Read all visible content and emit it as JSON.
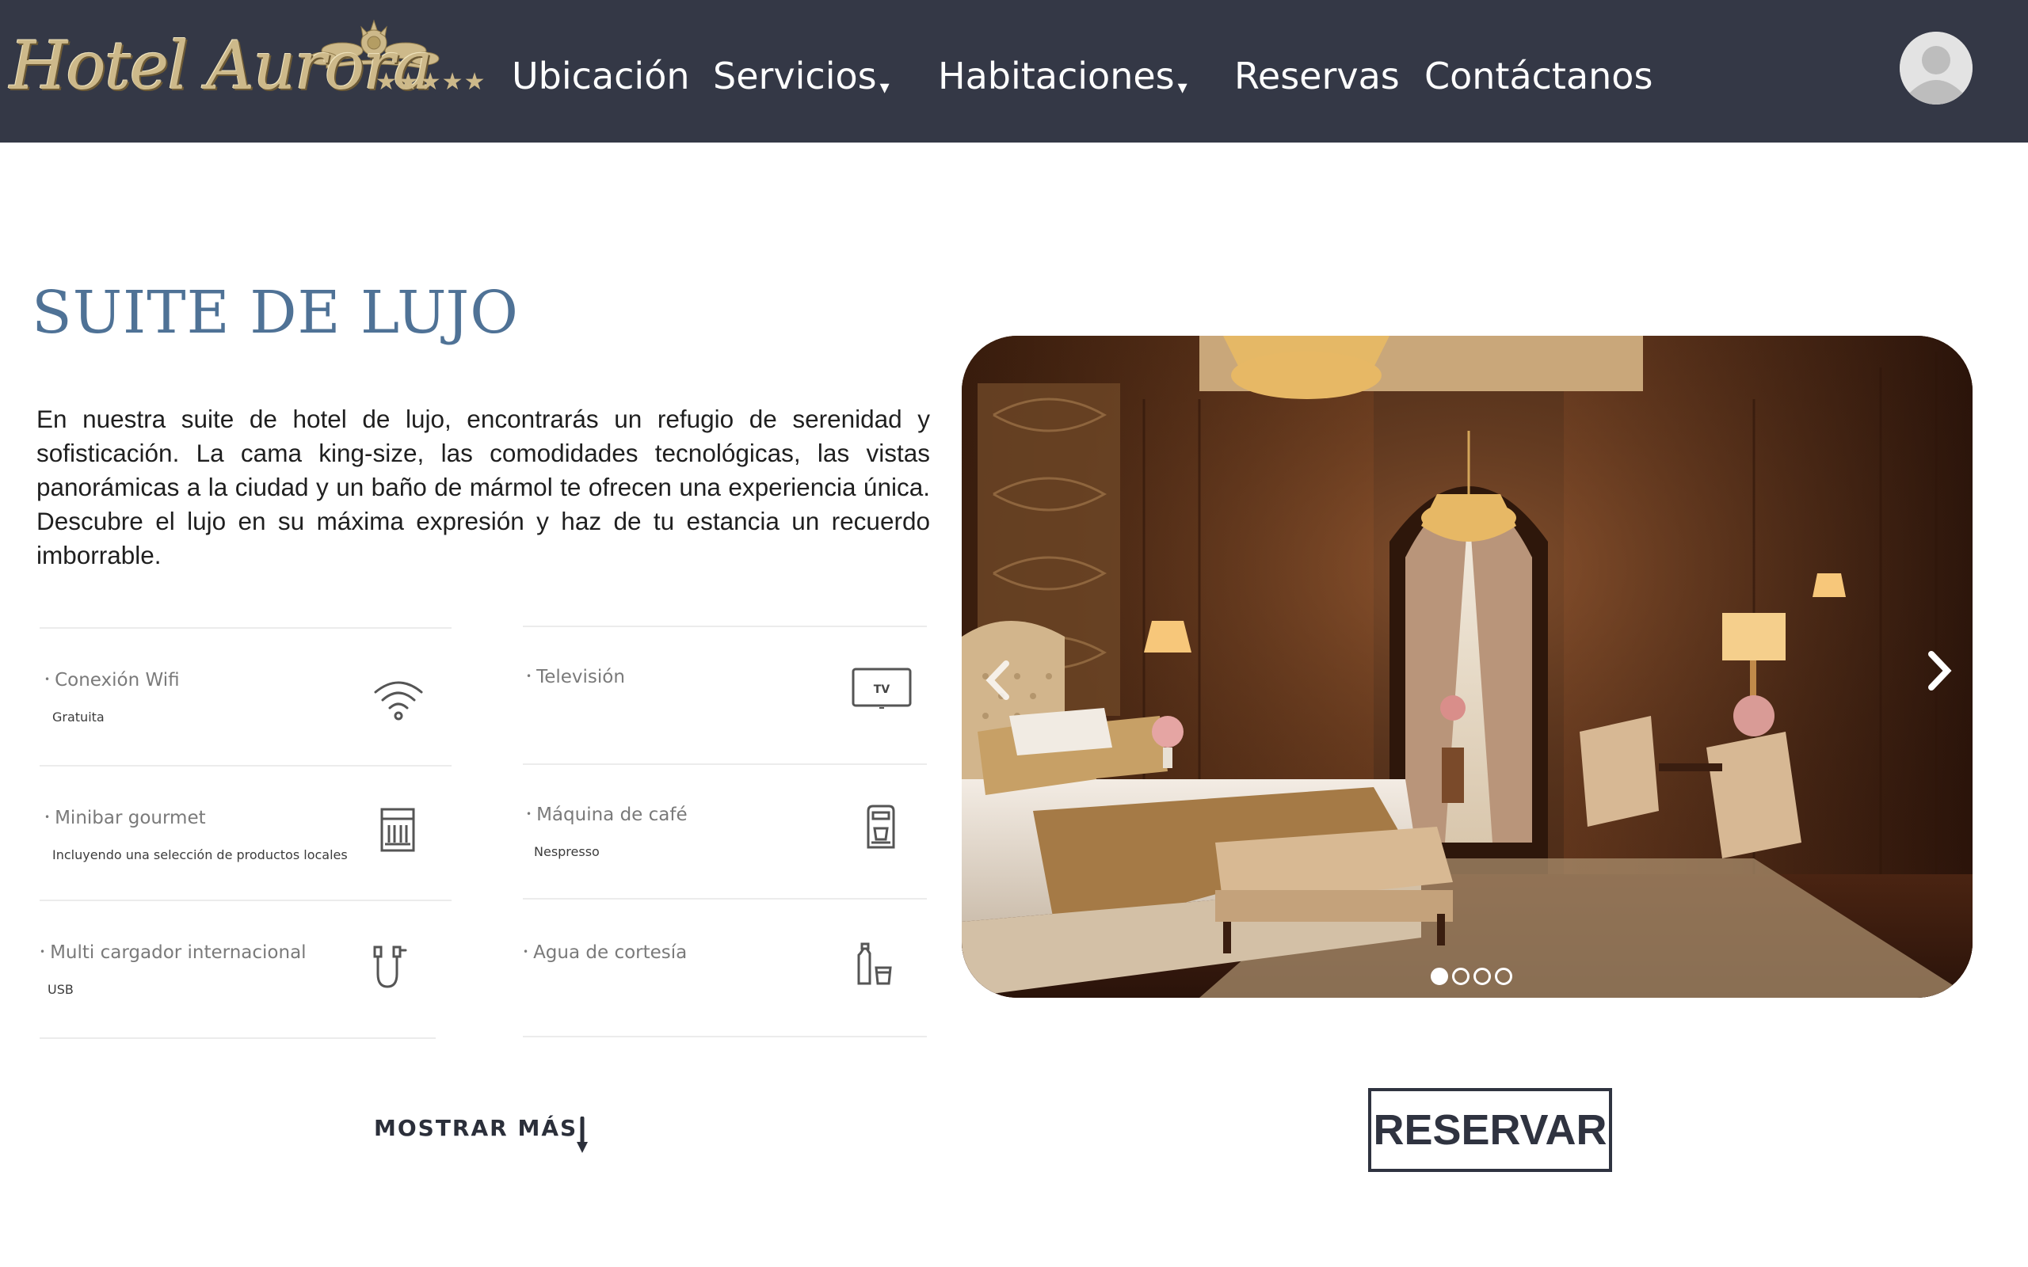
{
  "brand": {
    "name": "Hotel Aurora",
    "stars": "★★★★★"
  },
  "nav": {
    "items": [
      {
        "label": "Ubicación"
      },
      {
        "label": "Servicios",
        "caret": "▾"
      },
      {
        "label": "Habitaciones",
        "caret": "▾"
      },
      {
        "label": "Reservas"
      },
      {
        "label": "Contáctanos"
      }
    ]
  },
  "room": {
    "title": "SUITE DE LUJO",
    "description": "En nuestra suite de hotel de lujo, encontrarás un refugio de serenidad y sofisticación. La cama king-size, las comodidades tecnológicas, las vistas panorámicas a la ciudad y un baño de mármol te ofrecen una experiencia única. Descubre el lujo en su máxima expresión y haz de tu estancia un recuerdo imborrable."
  },
  "amenities": [
    {
      "name": "Conexión Wifi",
      "detail": "Gratuita",
      "icon": "wifi-icon"
    },
    {
      "name": "Televisión",
      "detail": "",
      "icon": "tv-icon",
      "icon_text": "TV"
    },
    {
      "name": "Minibar gourmet",
      "detail": "Incluyendo una selección de productos locales",
      "icon": "minibar-icon"
    },
    {
      "name": "Máquina de café",
      "detail": "Nespresso",
      "icon": "coffee-machine-icon"
    },
    {
      "name": "Multi cargador internacional",
      "detail": "USB",
      "icon": "charger-icon"
    },
    {
      "name": "Agua de cortesía",
      "detail": "",
      "icon": "water-bottle-icon"
    }
  ],
  "show_more": {
    "label": "MOSTRAR MÁS"
  },
  "carousel": {
    "slide_count": 4,
    "active_slide": 1
  },
  "reserve_button": {
    "label": "RESERVAR"
  },
  "colors": {
    "navbar": "#343846",
    "title": "#4f7296",
    "gold": "#cdb98a",
    "button_border": "#2f3340"
  }
}
